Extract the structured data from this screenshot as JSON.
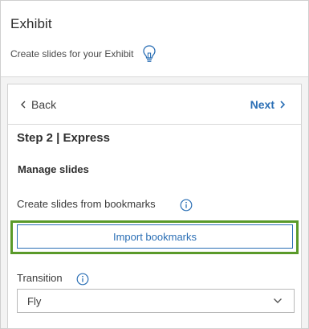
{
  "header": {
    "title": "Exhibit",
    "subtitle": "Create slides for your Exhibit"
  },
  "nav": {
    "back_label": "Back",
    "next_label": "Next"
  },
  "step": {
    "title": "Step 2 | Express",
    "section_title": "Manage slides"
  },
  "bookmarks": {
    "label": "Create slides from bookmarks",
    "import_button": "Import bookmarks"
  },
  "transition": {
    "label": "Transition",
    "selected": "Fly"
  },
  "colors": {
    "accent": "#2b6fb5",
    "highlight": "#5a9a2a"
  }
}
